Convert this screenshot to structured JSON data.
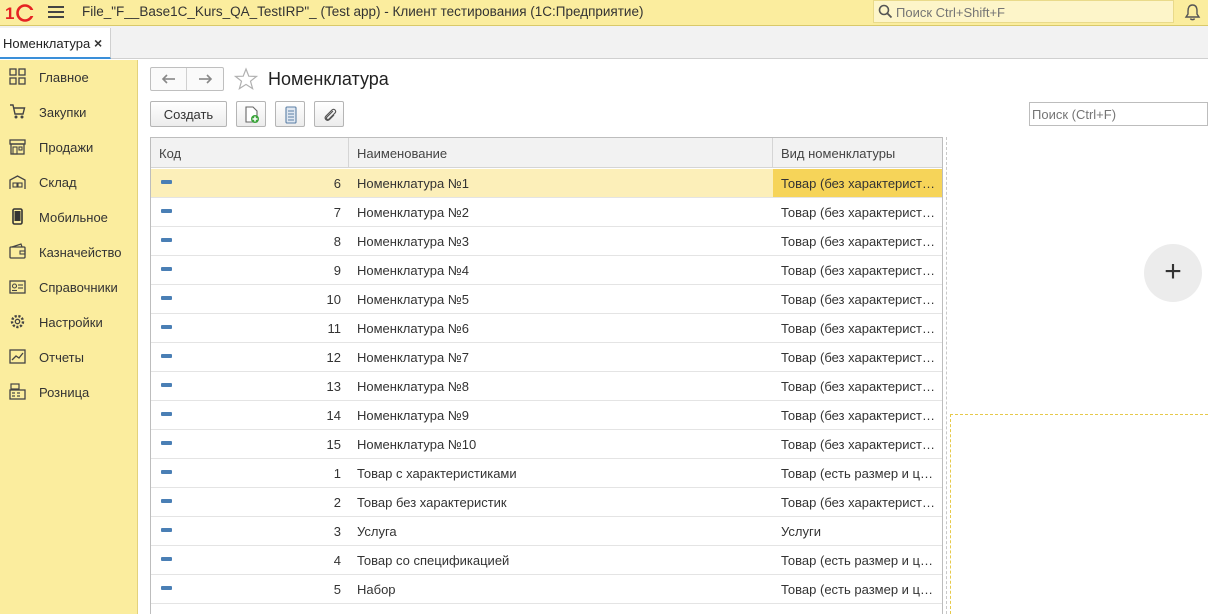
{
  "titlebar": {
    "app_title": "File_\"F__Base1C_Kurs_QA_TestIRP\"_ (Test app)  - Клиент тестирования (1С:Предприятие)",
    "search_placeholder": "Поиск Ctrl+Shift+F",
    "brand_color": "#e52222"
  },
  "tabs": [
    {
      "label": "Номенклатура",
      "close": "×"
    }
  ],
  "sidebar": {
    "items": [
      {
        "label": "Главное",
        "icon": "grid-icon"
      },
      {
        "label": "Закупки",
        "icon": "cart-icon"
      },
      {
        "label": "Продажи",
        "icon": "store-icon"
      },
      {
        "label": "Склад",
        "icon": "warehouse-icon"
      },
      {
        "label": "Мобильное",
        "icon": "phone-icon"
      },
      {
        "label": "Казначейство",
        "icon": "wallet-icon"
      },
      {
        "label": "Справочники",
        "icon": "directory-icon"
      },
      {
        "label": "Настройки",
        "icon": "gear-icon"
      },
      {
        "label": "Отчеты",
        "icon": "report-icon"
      },
      {
        "label": "Розница",
        "icon": "register-icon"
      }
    ]
  },
  "form": {
    "title": "Номенклатура",
    "create_label": "Создать",
    "search_placeholder": "Поиск (Ctrl+F)"
  },
  "table": {
    "columns": [
      "Код",
      "Наименование",
      "Вид номенклатуры"
    ],
    "rows": [
      {
        "code": "6",
        "name": "Номенклатура №1",
        "kind": "Товар (без характеристик)",
        "selected": true
      },
      {
        "code": "7",
        "name": "Номенклатура №2",
        "kind": "Товар (без характеристик)"
      },
      {
        "code": "8",
        "name": "Номенклатура №3",
        "kind": "Товар (без характеристик)"
      },
      {
        "code": "9",
        "name": "Номенклатура №4",
        "kind": "Товар (без характеристик)"
      },
      {
        "code": "10",
        "name": "Номенклатура №5",
        "kind": "Товар (без характеристик)"
      },
      {
        "code": "11",
        "name": "Номенклатура №6",
        "kind": "Товар (без характеристик)"
      },
      {
        "code": "12",
        "name": "Номенклатура №7",
        "kind": "Товар (без характеристик)"
      },
      {
        "code": "13",
        "name": "Номенклатура №8",
        "kind": "Товар (без характеристик)"
      },
      {
        "code": "14",
        "name": "Номенклатура №9",
        "kind": "Товар (без характеристик)"
      },
      {
        "code": "15",
        "name": "Номенклатура №10",
        "kind": "Товар (без характеристик)"
      },
      {
        "code": "1",
        "name": "Товар с характеристиками",
        "kind": "Товар (есть размер и цвет)"
      },
      {
        "code": "2",
        "name": "Товар без характеристик",
        "kind": "Товар (без характеристик)"
      },
      {
        "code": "3",
        "name": "Услуга",
        "kind": "Услуги"
      },
      {
        "code": "4",
        "name": "Товар со спецификацией",
        "kind": "Товар (есть размер и цвет)"
      },
      {
        "code": "5",
        "name": "Набор",
        "kind": "Товар (есть размер и цвет)"
      }
    ]
  },
  "right_panel": {
    "add_label": "+"
  }
}
